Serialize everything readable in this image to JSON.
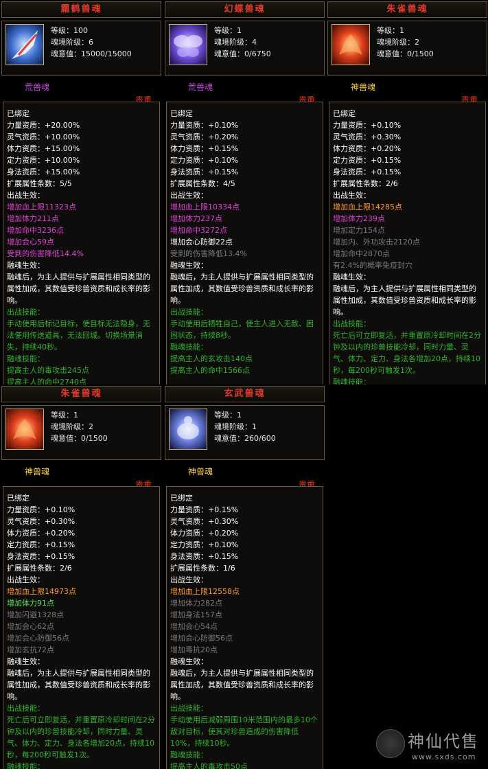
{
  "cards": [
    {
      "title": "霜鹤兽魂",
      "level": "等级：100",
      "stage": "魂境阶级：6",
      "will": "魂意值：15000/15000",
      "grade": "荒兽魂",
      "rarity": "贵重",
      "icon": "crane-beast-soul-icon",
      "lines": [
        {
          "t": "已绑定",
          "c": "white"
        },
        {
          "t": "力量资质：+20.00%",
          "c": "white"
        },
        {
          "t": "灵气资质：+10.00%",
          "c": "white"
        },
        {
          "t": "体力资质：+15.00%",
          "c": "white"
        },
        {
          "t": "定力资质：+10.00%",
          "c": "white"
        },
        {
          "t": "身法资质：+15.00%",
          "c": "white"
        },
        {
          "t": "扩展属性条数：5/5",
          "c": "white"
        },
        {
          "t": "出战生效：",
          "c": "white"
        },
        {
          "t": "增加血上限11323点",
          "c": "pink"
        },
        {
          "t": "增加体力211点",
          "c": "pink"
        },
        {
          "t": "增加命中3236点",
          "c": "pink"
        },
        {
          "t": "增加会心59点",
          "c": "pink"
        },
        {
          "t": "受到的伤害降低14.4%",
          "c": "pink"
        },
        {
          "t": "融魂生效：",
          "c": "white"
        },
        {
          "t": "融魂后，为主人提供与扩展属性相同类型的属性加成，其数值受珍兽资质和成长率的影响。",
          "c": "white",
          "wrap": true
        },
        {
          "t": "出战技能：",
          "c": "green"
        },
        {
          "t": "手动使用后标记目标，使目标无法隐身，无法使用传送道具，无法回城。切换场景消失，持续40秒。",
          "c": "green",
          "wrap": true
        },
        {
          "t": "融魂技能：",
          "c": "green"
        },
        {
          "t": "提高主人的毒攻击245点",
          "c": "green"
        },
        {
          "t": "提高主人的命中2740点",
          "c": "green"
        }
      ]
    },
    {
      "title": "幻蝶兽魂",
      "level": "等级：1",
      "stage": "魂境阶级：4",
      "will": "魂意值：0/6750",
      "grade": "荒兽魂",
      "rarity": "贵重",
      "icon": "butterfly-beast-soul-icon",
      "lines": [
        {
          "t": "已绑定",
          "c": "white"
        },
        {
          "t": "力量资质：+0.10%",
          "c": "white"
        },
        {
          "t": "灵气资质：+0.20%",
          "c": "white"
        },
        {
          "t": "体力资质：+0.15%",
          "c": "white"
        },
        {
          "t": "定力资质：+0.10%",
          "c": "white"
        },
        {
          "t": "身法资质：+0.15%",
          "c": "white"
        },
        {
          "t": "扩展属性条数：4/5",
          "c": "white"
        },
        {
          "t": "出战生效：",
          "c": "white"
        },
        {
          "t": "增加血上限10334点",
          "c": "pink"
        },
        {
          "t": "增加体力237点",
          "c": "pink"
        },
        {
          "t": "增加命中3272点",
          "c": "pink"
        },
        {
          "t": "增加会心防御22点",
          "c": "white"
        },
        {
          "t": "受到的伤害降低13.4%",
          "c": "gray"
        },
        {
          "t": "融魂生效：",
          "c": "white"
        },
        {
          "t": "融魂后，为主人提供与扩展属性相同类型的属性加成，其数值受珍兽资质和成长率的影响。",
          "c": "white",
          "wrap": true
        },
        {
          "t": "出战技能：",
          "c": "green"
        },
        {
          "t": "手动使用后牺牲自己，使主人进入无敌、困困状态，持续8秒。",
          "c": "green",
          "wrap": true
        },
        {
          "t": "融魂技能：",
          "c": "green"
        },
        {
          "t": "提高主人的玄攻击140点",
          "c": "green"
        },
        {
          "t": "提高主人的命中1566点",
          "c": "green"
        }
      ]
    },
    {
      "title": "朱雀兽魂",
      "level": "等级：1",
      "stage": "魂境阶级：2",
      "will": "魂意值：0/1500",
      "grade": "神兽魂",
      "rarity": "贵重",
      "icon": "vermilion-bird-soul-icon",
      "lines": [
        {
          "t": "已绑定",
          "c": "white"
        },
        {
          "t": "力量资质：+0.10%",
          "c": "white"
        },
        {
          "t": "灵气资质：+0.30%",
          "c": "white"
        },
        {
          "t": "体力资质：+0.20%",
          "c": "white"
        },
        {
          "t": "定力资质：+0.15%",
          "c": "white"
        },
        {
          "t": "身法资质：+0.15%",
          "c": "white"
        },
        {
          "t": "扩展属性条数：2/6",
          "c": "white"
        },
        {
          "t": "出战生效：",
          "c": "white"
        },
        {
          "t": "增加血上限14285点",
          "c": "orange"
        },
        {
          "t": "增加体力239点",
          "c": "pink"
        },
        {
          "t": "增加定力154点",
          "c": "gray"
        },
        {
          "t": "增加内、外功攻击2120点",
          "c": "gray"
        },
        {
          "t": "增加命中2870点",
          "c": "gray"
        },
        {
          "t": "有2.4%的概率免疫封穴",
          "c": "gray"
        },
        {
          "t": "融魂生效：",
          "c": "white"
        },
        {
          "t": "融魂后，为主人提供与扩展属性相同类型的属性加成，其数值受珍兽资质和成长率的影响。",
          "c": "white",
          "wrap": true
        },
        {
          "t": "出战技能：",
          "c": "green"
        },
        {
          "t": "死亡后可立即复活，并重置原冷却时间在2分钟及以内的珍兽技能冷却，同时力量、灵气、体力、定力、身法各增加20点，持续10秒，每200秒可触发1次。",
          "c": "green",
          "wrap": true
        },
        {
          "t": "融魂技能：",
          "c": "green"
        }
      ]
    },
    {
      "title": "朱雀兽魂",
      "level": "等级：1",
      "stage": "魂境阶级：2",
      "will": "魂意值：0/1500",
      "grade": "神兽魂",
      "rarity": "贵重",
      "icon": "vermilion-bird-soul-icon",
      "lines": [
        {
          "t": "已绑定",
          "c": "white"
        },
        {
          "t": "力量资质：+0.10%",
          "c": "white"
        },
        {
          "t": "灵气资质：+0.30%",
          "c": "white"
        },
        {
          "t": "体力资质：+0.20%",
          "c": "white"
        },
        {
          "t": "定力资质：+0.15%",
          "c": "white"
        },
        {
          "t": "身法资质：+0.15%",
          "c": "white"
        },
        {
          "t": "扩展属性条数：2/6",
          "c": "white"
        },
        {
          "t": "出战生效：",
          "c": "white"
        },
        {
          "t": "增加血上限14973点",
          "c": "orange"
        },
        {
          "t": "增加体力91点",
          "c": "bright"
        },
        {
          "t": "增加闪避1328点",
          "c": "gray"
        },
        {
          "t": "增加会心62点",
          "c": "gray"
        },
        {
          "t": "增加会心防御56点",
          "c": "gray"
        },
        {
          "t": "增加玄抗72点",
          "c": "gray"
        },
        {
          "t": "融魂生效：",
          "c": "white"
        },
        {
          "t": "融魂后，为主人提供与扩展属性相同类型的属性加成，其数值受珍兽资质和成长率的影响。",
          "c": "white",
          "wrap": true
        },
        {
          "t": "出战技能：",
          "c": "green"
        },
        {
          "t": "死亡后可立即复活，并重置原冷却时间在2分钟及以内的珍兽技能冷却，同时力量、灵气、体力、定力、身法各增加20点，持续10秒，每200秒可触发1次。",
          "c": "green",
          "wrap": true
        },
        {
          "t": "融魂技能：",
          "c": "green"
        }
      ]
    },
    {
      "title": "玄武兽魂",
      "level": "等级：1",
      "stage": "魂境阶级：1",
      "will": "魂意值：260/600",
      "grade": "神兽魂",
      "rarity": "贵重",
      "icon": "black-tortoise-soul-icon",
      "lines": [
        {
          "t": "已绑定",
          "c": "white"
        },
        {
          "t": "力量资质：+0.15%",
          "c": "white"
        },
        {
          "t": "灵气资质：+0.30%",
          "c": "white"
        },
        {
          "t": "体力资质：+0.20%",
          "c": "white"
        },
        {
          "t": "定力资质：+0.10%",
          "c": "white"
        },
        {
          "t": "身法资质：+0.15%",
          "c": "white"
        },
        {
          "t": "扩展属性条数：1/6",
          "c": "white"
        },
        {
          "t": "出战生效：",
          "c": "white"
        },
        {
          "t": "增加血上限12558点",
          "c": "orange"
        },
        {
          "t": "增加体力282点",
          "c": "gray"
        },
        {
          "t": "增加身法157点",
          "c": "gray"
        },
        {
          "t": "增加会心54点",
          "c": "gray"
        },
        {
          "t": "增加会心防御56点",
          "c": "gray"
        },
        {
          "t": "增加毒抗20点",
          "c": "gray"
        },
        {
          "t": "融魂生效：",
          "c": "white"
        },
        {
          "t": "融魂后，为主人提供与扩展属性相同类型的属性加成，其数值受珍兽资质和成长率的影响。",
          "c": "white",
          "wrap": true
        },
        {
          "t": "出战技能：",
          "c": "green"
        },
        {
          "t": "手动使用后减弱周围10米范围内的最多10个敌对目标，使其对珍兽造成的伤害降低10%，持续10秒。",
          "c": "green",
          "wrap": true
        },
        {
          "t": "融魂技能：",
          "c": "green"
        },
        {
          "t": "提高主人的毒攻击50点",
          "c": "green"
        }
      ]
    }
  ],
  "watermark": {
    "text": "神仙代售",
    "url": "www.sxds.com"
  }
}
